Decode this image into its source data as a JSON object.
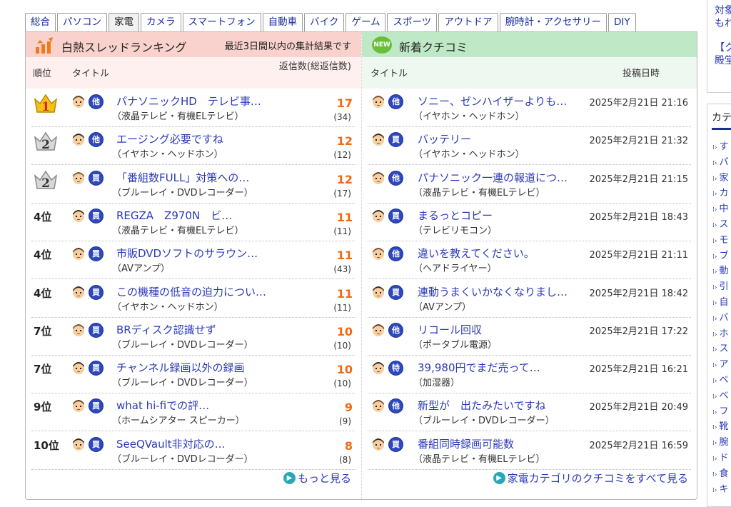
{
  "tabs": [
    {
      "label": "総合",
      "active": false
    },
    {
      "label": "パソコン",
      "active": false
    },
    {
      "label": "家電",
      "active": true
    },
    {
      "label": "カメラ",
      "active": false
    },
    {
      "label": "スマートフォン",
      "active": false
    },
    {
      "label": "自動車",
      "active": false
    },
    {
      "label": "バイク",
      "active": false
    },
    {
      "label": "ゲーム",
      "active": false
    },
    {
      "label": "スポーツ",
      "active": false
    },
    {
      "label": "アウトドア",
      "active": false
    },
    {
      "label": "腕時計・アクセサリー",
      "active": false
    },
    {
      "label": "DIY",
      "active": false
    }
  ],
  "ranking": {
    "title": "白熱スレッドランキング",
    "note": "最近3日間以内の集計結果です",
    "col_rank": "順位",
    "col_title": "タイトル",
    "col_count": "返信数(総返信数)",
    "more": "もっと見る",
    "rows": [
      {
        "rank": "1",
        "badge": "他",
        "title": "パナソニックHD　テレビ事…",
        "category": "（液晶テレビ・有機ELテレビ）",
        "count": "17",
        "total": "(34)"
      },
      {
        "rank": "2",
        "badge": "他",
        "title": "エージング必要ですね",
        "category": "（イヤホン・ヘッドホン）",
        "count": "12",
        "total": "(12)"
      },
      {
        "rank": "2",
        "badge": "買",
        "title": "「番組数FULL」対策への…",
        "category": "（ブルーレイ・DVDレコーダー）",
        "count": "12",
        "total": "(17)"
      },
      {
        "rank": "4位",
        "badge": "買",
        "title": "REGZA　Z970N　ビ…",
        "category": "（液晶テレビ・有機ELテレビ）",
        "count": "11",
        "total": "(11)"
      },
      {
        "rank": "4位",
        "badge": "買",
        "title": "市販DVDソフトのサラウン…",
        "category": "（AVアンプ）",
        "count": "11",
        "total": "(43)"
      },
      {
        "rank": "4位",
        "badge": "買",
        "title": "この機種の低音の迫力につい…",
        "category": "（イヤホン・ヘッドホン）",
        "count": "11",
        "total": "(11)"
      },
      {
        "rank": "7位",
        "badge": "買",
        "title": "BRディスク認識せず",
        "category": "（ブルーレイ・DVDレコーダー）",
        "count": "10",
        "total": "(10)"
      },
      {
        "rank": "7位",
        "badge": "買",
        "title": "チャンネル録画以外の録画",
        "category": "（ブルーレイ・DVDレコーダー）",
        "count": "10",
        "total": "(10)"
      },
      {
        "rank": "9位",
        "badge": "買",
        "title": "what hi-fiでの評…",
        "category": "（ホームシアター スピーカー）",
        "count": "9",
        "total": "(9)"
      },
      {
        "rank": "10位",
        "badge": "買",
        "title": "SeeQVault非対応の…",
        "category": "（ブルーレイ・DVDレコーダー）",
        "count": "8",
        "total": "(8)"
      }
    ]
  },
  "reviews": {
    "new_badge": "NEW",
    "title": "新着クチコミ",
    "col_title": "タイトル",
    "col_date": "投稿日時",
    "more": "家電カテゴリのクチコミをすべて見る",
    "rows": [
      {
        "badge": "他",
        "title": "ソニー、ゼンハイザーよりも…",
        "category": "（イヤホン・ヘッドホン）",
        "date": "2025年2月21日 21:16"
      },
      {
        "badge": "買",
        "title": "バッテリー",
        "category": "（イヤホン・ヘッドホン）",
        "date": "2025年2月21日 21:32"
      },
      {
        "badge": "他",
        "title": "パナソニック一連の報道につ…",
        "category": "（液晶テレビ・有機ELテレビ）",
        "date": "2025年2月21日 21:15"
      },
      {
        "badge": "買",
        "title": "まるっとコピー",
        "category": "（テレビリモコン）",
        "date": "2025年2月21日 18:43"
      },
      {
        "badge": "他",
        "title": "違いを教えてください。",
        "category": "（ヘアドライヤー）",
        "date": "2025年2月21日 21:11"
      },
      {
        "badge": "買",
        "title": "連動うまくいかなくなりまし…",
        "category": "（AVアンプ）",
        "date": "2025年2月21日 18:42"
      },
      {
        "badge": "他",
        "title": "リコール回収",
        "category": "（ポータブル電源）",
        "date": "2025年2月21日 17:22"
      },
      {
        "badge": "特",
        "title": "39,980円でまだ売って…",
        "category": "（加湿器）",
        "date": "2025年2月21日 16:21"
      },
      {
        "badge": "他",
        "title": "新型が　出たみたいですね",
        "category": "（ブルーレイ・DVDレコーダー）",
        "date": "2025年2月21日 20:49"
      },
      {
        "badge": "買",
        "title": "番組同時録画可能数",
        "category": "（液晶テレビ・有機ELテレビ）",
        "date": "2025年2月21日 16:59"
      }
    ]
  },
  "sidebar": {
    "top_lines": [
      "対象",
      "もれ",
      "【クチ",
      "殿堂"
    ],
    "head": "カテ",
    "items": [
      "す",
      "パ",
      "家",
      "カ",
      "中",
      "ス",
      "モ",
      "ブ",
      "動",
      "引",
      "自",
      "バ",
      "ホ",
      "ス",
      "ア",
      "ベ",
      "ベ",
      "フ",
      "靴",
      "腕",
      "ド",
      "食",
      "キ"
    ]
  },
  "colors": {
    "ranking_header": "#f9d2cd",
    "reviews_header": "#bfe8c7",
    "link": "#2b3ab8",
    "count": "#f06a14",
    "badge": "#2e48c0"
  }
}
